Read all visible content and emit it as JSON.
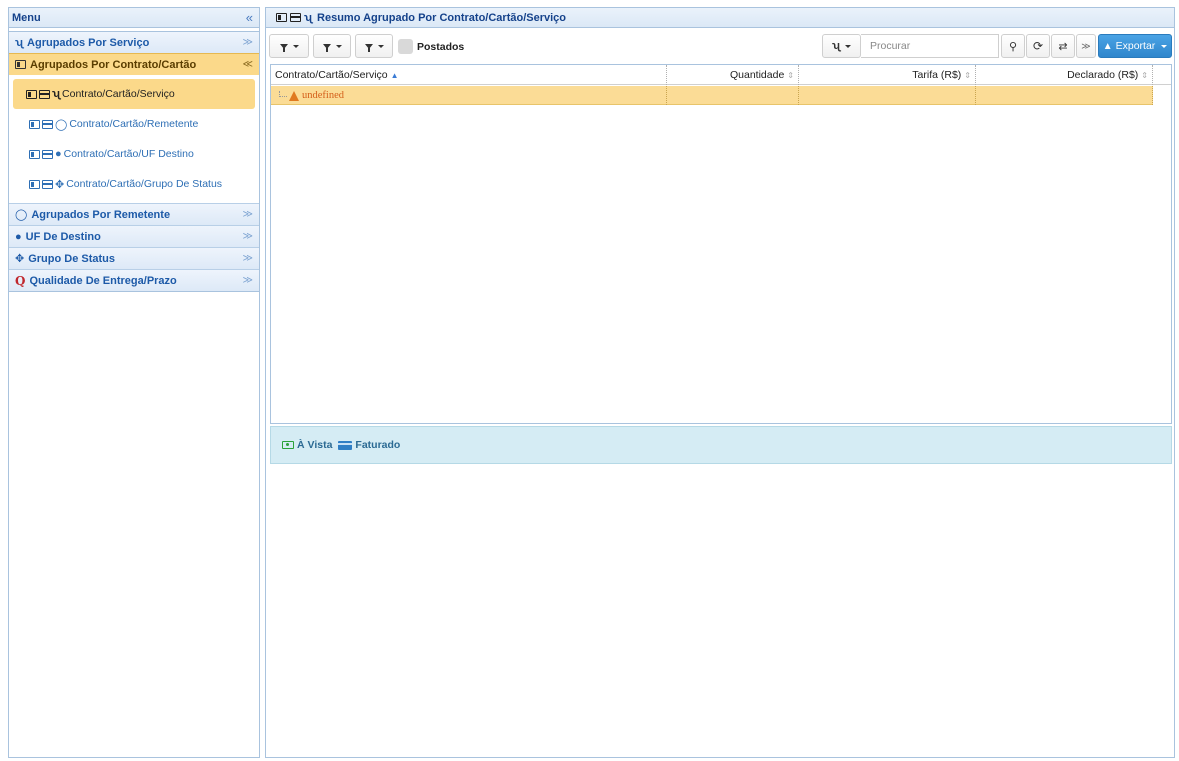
{
  "menu": {
    "title": "Menu",
    "collapse_glyph": "«",
    "sections": [
      {
        "label": "Agrupados Por Serviço",
        "icon": "service-icon",
        "chev": "≫"
      },
      {
        "label": "Agrupados Por Contrato/Cartão",
        "icon": "contract-card-icon",
        "chev": "≪",
        "active": true,
        "items": [
          {
            "label": "Contrato/Cartão/Serviço",
            "selected": true
          },
          {
            "label": "Contrato/Cartão/Remetente"
          },
          {
            "label": "Contrato/Cartão/UF Destino"
          },
          {
            "label": "Contrato/Cartão/Grupo De Status"
          }
        ]
      },
      {
        "label": "Agrupados Por Remetente",
        "icon": "user-icon",
        "chev": "≫"
      },
      {
        "label": "UF De Destino",
        "icon": "map-marker-icon",
        "chev": "≫"
      },
      {
        "label": "Grupo De Status",
        "icon": "arrows-move-icon",
        "chev": "≫"
      },
      {
        "label": "Qualidade De Entrega/Prazo",
        "icon": "quality-icon",
        "chev": "≫"
      }
    ]
  },
  "main": {
    "title": "Resumo Agrupado Por Contrato/Cartão/Serviço",
    "toolbar": {
      "postados_label": "Postados",
      "search_placeholder": "Procurar",
      "export_label": "Exportar"
    },
    "grid": {
      "columns": [
        "Contrato/Cartão/Serviço",
        "Quantidade",
        "Tarifa (R$)",
        "Declarado (R$)"
      ],
      "rows": [
        {
          "group": "undefined",
          "quantidade": "",
          "tarifa": "",
          "declarado": ""
        }
      ]
    },
    "legend": {
      "a_vista": "À Vista",
      "faturado": "Faturado"
    }
  },
  "colors": {
    "accent": "#2f86cc",
    "active_row": "#fbd98a",
    "header_text": "#15428b",
    "warning": "#e07a20"
  }
}
